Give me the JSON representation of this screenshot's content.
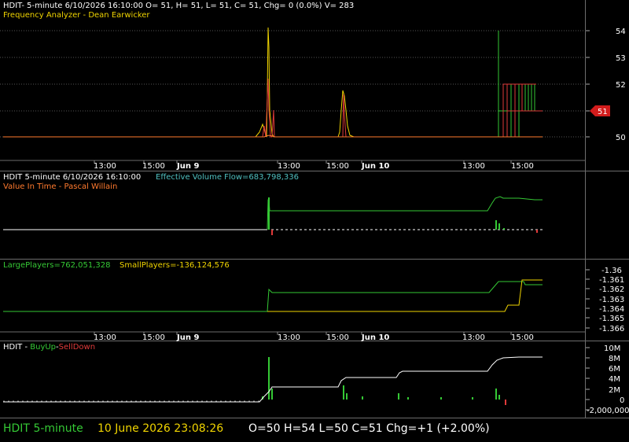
{
  "colors": {
    "white": "#ffffff",
    "yellow": "#f0d400",
    "green": "#35c935",
    "red": "#e03a3a",
    "orange": "#ff7a2e",
    "cyan": "#4fc0c0",
    "grid": "#555555",
    "marker": "#d21c1c"
  },
  "pane1": {
    "header": "HDIT- 5-minute 6/10/2026 16:10:00 O= 51, H= 51, L= 51, C= 51, Chg= 0 (0.0%) V= 283",
    "indicator": "Frequency Analyzer - Dean Earwicker",
    "price_marker": "51",
    "y_ticks": [
      "54",
      "53",
      "52",
      "51",
      "50"
    ],
    "x_ticks": [
      "13:00",
      "15:00",
      "Jun 9",
      "13:00",
      "15:00",
      "Jun 10",
      "13:00",
      "15:00"
    ]
  },
  "pane2": {
    "header": "HDIT 5-minute  6/10/2026 16:10:00",
    "effective_volume_flow": "Effective Volume Flow=683,798,336",
    "indicator": "Value In Time - Pascal Willain"
  },
  "pane3": {
    "large_players": "LargePlayers=762,051,328",
    "small_players": "SmallPlayers=-136,124,576",
    "y_ticks": [
      "-1.36",
      "-1.361",
      "-1.362",
      "-1.363",
      "-1.364",
      "-1.365",
      "-1.366"
    ],
    "x_ticks": [
      "13:00",
      "15:00",
      "Jun 9",
      "13:00",
      "15:00",
      "Jun 10",
      "13:00",
      "15:00"
    ]
  },
  "pane4": {
    "symbol": "HDIT - ",
    "buy_up": "BuyUp",
    "sep": "-",
    "sell_down": "SellDown",
    "y_ticks": [
      "10M",
      "8M",
      "6M",
      "4M",
      "2M",
      "0",
      "-2,000,000"
    ]
  },
  "status_bar": {
    "symbol": "HDIT  5-minute",
    "datetime": "10 June 2026 23:08:26",
    "ohlc": "O=50  H=54  L=50  C=51  Chg=+1 (+2.00%)"
  }
}
